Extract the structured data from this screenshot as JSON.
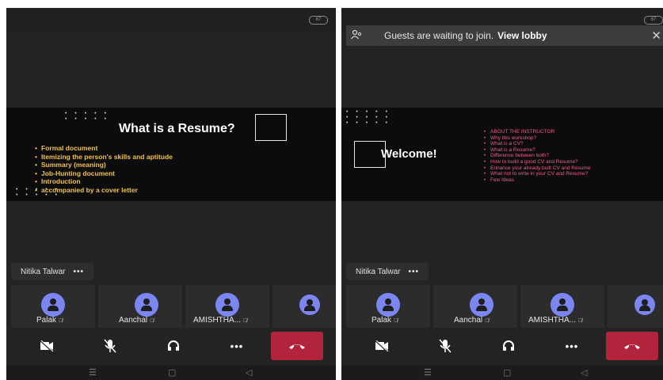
{
  "left": {
    "battery": "67",
    "slide": {
      "title": "What is a Resume?",
      "bullets": [
        "Formal document",
        "Itemizing the person's skills and aptitude",
        "Summary (meaning)",
        "Job-Hunting document",
        "Introduction",
        "accompanied by a cover letter"
      ]
    },
    "presenter": {
      "name": "Nitika Talwar",
      "more": "•••"
    },
    "participants": [
      {
        "name": "Palak"
      },
      {
        "name": "Aanchal"
      },
      {
        "name": "AMISHTHA..."
      }
    ]
  },
  "right": {
    "battery": "67",
    "banner": {
      "text": "Guests are waiting to join.",
      "link": "View lobby",
      "close": "✕"
    },
    "slide": {
      "title": "Welcome!",
      "agenda": [
        "ABOUT THE INSTRUCTOR",
        "Why this workshop?",
        "What is a CV?",
        "What is a Resume?",
        "Difference between both?",
        "How to build a good CV and Resume?",
        "Enhance your already built CV and Resume",
        "What not to write in your CV and Resume?",
        "Few Ideas"
      ]
    },
    "presenter": {
      "name": "Nitika Talwar",
      "more": "•••"
    },
    "participants": [
      {
        "name": "Palak"
      },
      {
        "name": "Aanchal"
      },
      {
        "name": "AMISHTHA..."
      }
    ]
  },
  "controls": {
    "more": "•••"
  },
  "icons": {
    "camera_off": "video-off-icon",
    "mic_off": "mic-off-icon",
    "audio": "headset-icon",
    "end_call": "phone-hangup-icon",
    "people": "people-icon"
  },
  "colors": {
    "background": "#232323",
    "avatar": "#7b86f3",
    "end_call": "#b1243b",
    "slide_bullets_left": "#f2c14e",
    "slide_bullets_right": "#ee5f86"
  }
}
